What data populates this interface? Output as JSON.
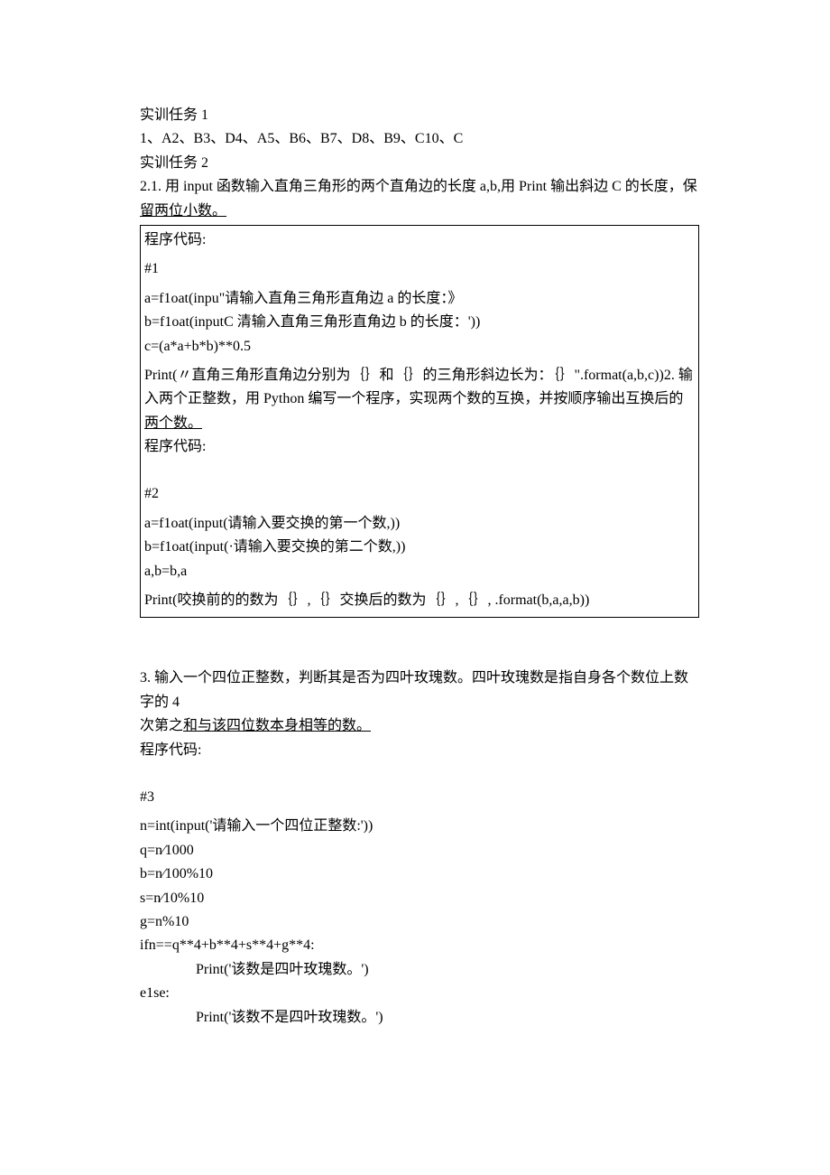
{
  "header": {
    "task1_title": "实训任务 1",
    "task1_answers": "1、A2、B3、D4、A5、B6、B7、D8、B9、C10、C",
    "task2_title": "实训任务 2"
  },
  "q21": {
    "prompt_prefix": "2.1.   用 input 函数输入直角三角形的两个直角边的长度 a,b,用 Print 输出斜边 C 的长度，保",
    "prompt_underlined": "留两位小数。",
    "code_label": "程序代码:",
    "hash1": "#1",
    "a_line": "a=f1oat(inpu\"请输入直角三角形直角边 a 的长度：》",
    "b_line": "b=f1oat(inputC 清输入直角三角形直角边 b 的长度：'))",
    "c_line": "c=(a*a+b*b)**0.5",
    "print_prefix": "Print(〃直角三角形直角边分别为｛｝和｛｝的三角形斜边长为：｛｝\".format(a,b,c))2. 输入两个正整数，用 Python 编写一个程序，实现两个数的互换，并按顺序输出互换后的",
    "print_underlined": "两个数。",
    "code_label2": "程序代码:",
    "hash2": "#2",
    "a2_line": "a=f1oat(input(请输入要交换的第一个数,))",
    "b2_line": "b=f1oat(input(·请输入要交换的第二个数,))",
    "swap_line": "a,b=b,a",
    "print2_line": "Print(咬换前的的数为｛｝,｛｝交换后的数为｛｝,｛｝, .format(b,a,a,b))"
  },
  "q3": {
    "prompt_line1": "3. 输入一个四位正整数，判断其是否为四叶玫瑰数。四叶玫瑰数是指自身各个数位上数字的 4",
    "prompt_prefix2": "次第之",
    "prompt_underlined2": "和与该四位数本身相等的数。",
    "code_label": "程序代码:",
    "hash3": "#3",
    "n_line": "n=int(input('请输入一个四位正整数:'))",
    "q_line": "q=n⁄1000",
    "b_line": "b=n⁄100%10",
    "s_line": "s=n⁄10%10",
    "g_line": "g=n%10",
    "if_line": "ifn==q**4+b**4+s**4+g**4:",
    "print_true": "Print('该数是四叶玫瑰数。')",
    "else_line": "e1se:",
    "print_false": "Print('该数不是四叶玫瑰数。')"
  }
}
